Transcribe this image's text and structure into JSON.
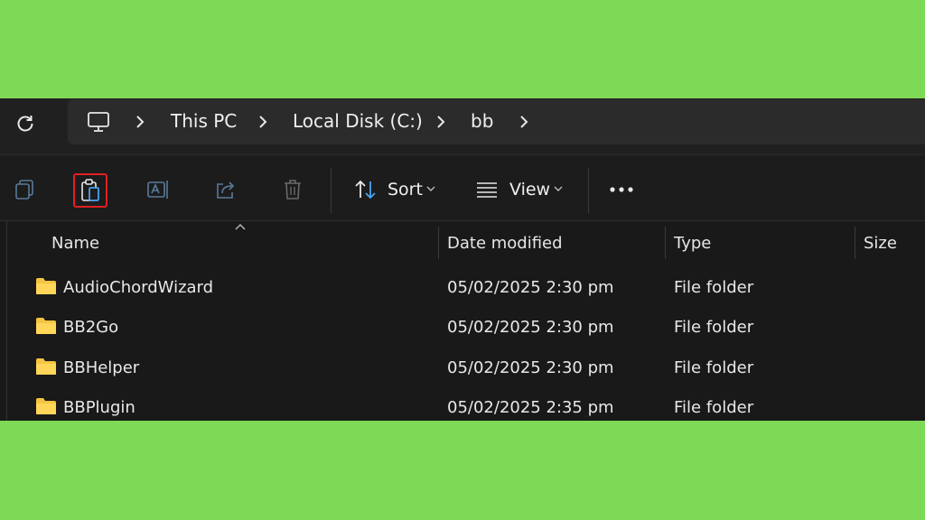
{
  "address_bar": {
    "breadcrumbs": [
      "This PC",
      "Local Disk (C:)",
      "bb"
    ]
  },
  "toolbar": {
    "sort_label": "Sort",
    "view_label": "View"
  },
  "columns": [
    "Name",
    "Date modified",
    "Type",
    "Size"
  ],
  "rows": [
    {
      "name": "AudioChordWizard",
      "date": "05/02/2025 2:30 pm",
      "type": "File folder"
    },
    {
      "name": "BB2Go",
      "date": "05/02/2025 2:30 pm",
      "type": "File folder"
    },
    {
      "name": "BBHelper",
      "date": "05/02/2025 2:30 pm",
      "type": "File folder"
    },
    {
      "name": "BBPlugin",
      "date": "05/02/2025 2:35 pm",
      "type": "File folder"
    }
  ],
  "colors": {
    "background": "#7ed957",
    "highlight": "#e02020",
    "folder": "#f5c542"
  }
}
